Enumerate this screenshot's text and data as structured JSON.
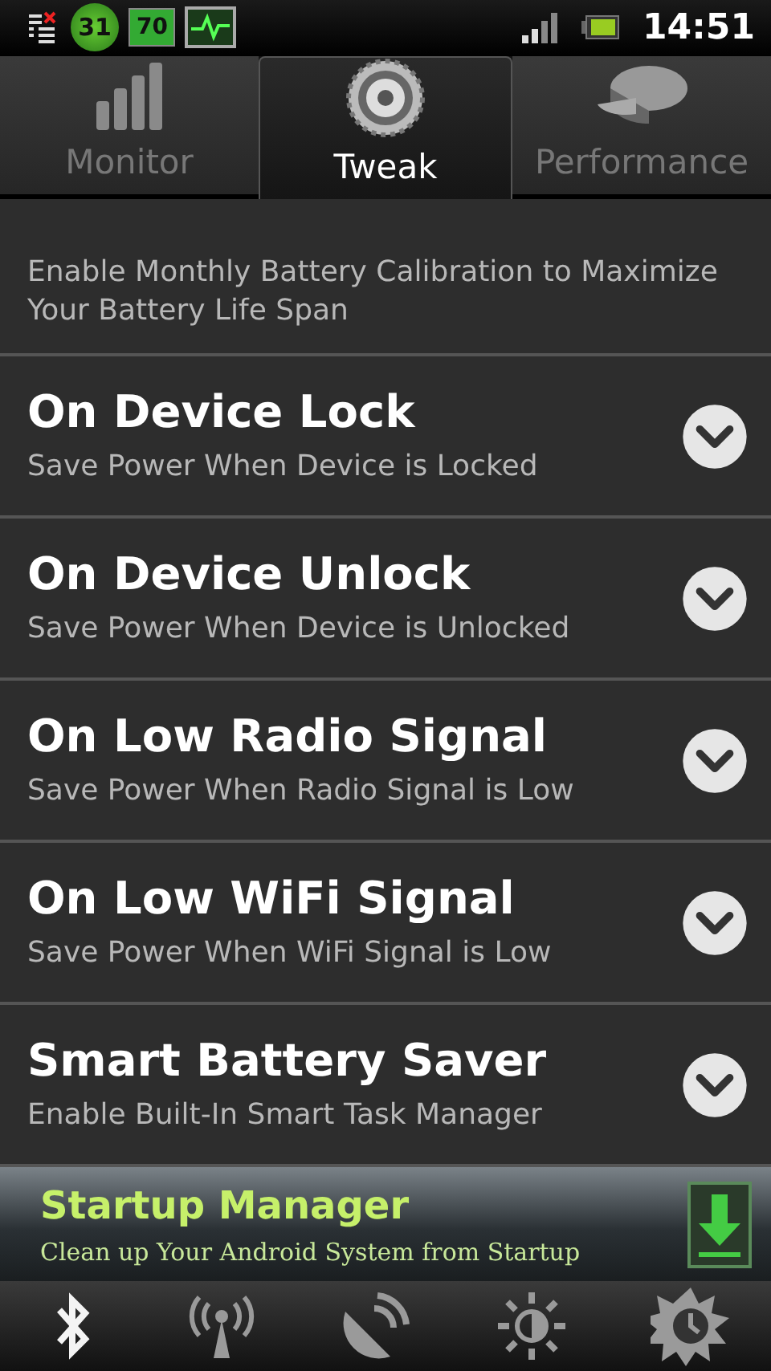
{
  "status_bar": {
    "temperature": "31",
    "battery_percent": "70",
    "clock": "14:51"
  },
  "tabs": [
    {
      "label": "Monitor",
      "kind": "bars",
      "selected": false
    },
    {
      "label": "Tweak",
      "kind": "gear",
      "selected": true
    },
    {
      "label": "Performance",
      "kind": "pie",
      "selected": false
    }
  ],
  "partial_item": {
    "description": "Enable Monthly Battery Calibration to Maximize Your Battery Life Span"
  },
  "settings": [
    {
      "title": "On Device Lock",
      "description": "Save Power When Device is Locked",
      "expanded": false
    },
    {
      "title": "On Device Unlock",
      "description": "Save Power When Device is Unlocked",
      "expanded": false
    },
    {
      "title": "On Low Radio Signal",
      "description": "Save Power When Radio Signal is Low",
      "expanded": false
    },
    {
      "title": "On Low WiFi Signal",
      "description": "Save Power When WiFi Signal is Low",
      "expanded": false
    },
    {
      "title": "Smart Battery Saver",
      "description": "Enable Built-In Smart Task Manager",
      "expanded": false
    }
  ],
  "ad": {
    "title": "Startup Manager",
    "text": "Clean up Your Android System from Startup"
  },
  "quick_toggles": [
    {
      "kind": "bluetooth",
      "on": true
    },
    {
      "kind": "radio",
      "on": false
    },
    {
      "kind": "gps",
      "on": false
    },
    {
      "kind": "brightness",
      "on": false
    },
    {
      "kind": "timeout",
      "on": false
    }
  ]
}
